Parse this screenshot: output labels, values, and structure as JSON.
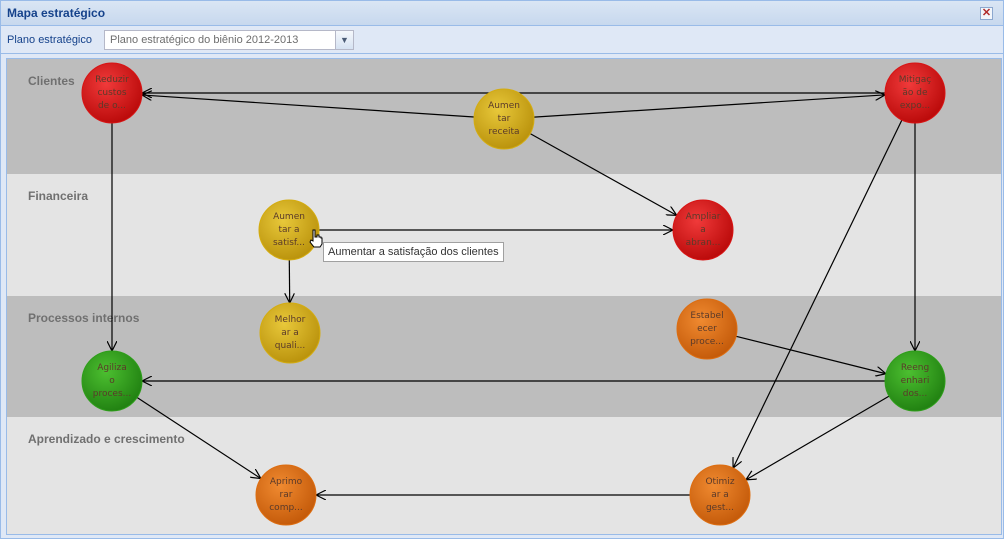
{
  "window": {
    "title": "Mapa estratégico"
  },
  "toolbar": {
    "plan_label": "Plano estratégico",
    "plan_value": "Plano estratégico do biênio 2012-2013"
  },
  "lanes": [
    {
      "label": "Clientes",
      "color": "#bdbdbd"
    },
    {
      "label": "Financeira",
      "color": "#e4e4e4"
    },
    {
      "label": "Processos internos",
      "color": "#bdbdbd"
    },
    {
      "label": "Aprendizado e crescimento",
      "color": "#e4e4e4"
    }
  ],
  "nodes": [
    {
      "id": "reduzir",
      "lines": [
        "Reduzir",
        "custos",
        "de o..."
      ],
      "color": "red"
    },
    {
      "id": "aumentar-receita",
      "lines": [
        "Aumen",
        "tar",
        "receita"
      ],
      "color": "yellow"
    },
    {
      "id": "mitigacao",
      "lines": [
        "Mitigaç",
        "ão de",
        "expo..."
      ],
      "color": "red"
    },
    {
      "id": "aumentar-satisf",
      "lines": [
        "Aumen",
        "tar a",
        "satisf..."
      ],
      "color": "yellow"
    },
    {
      "id": "ampliar",
      "lines": [
        "Ampliar",
        "a",
        "abran..."
      ],
      "color": "red"
    },
    {
      "id": "melhorar",
      "lines": [
        "Melhor",
        "ar a",
        "quali..."
      ],
      "color": "yellow"
    },
    {
      "id": "estabelecer",
      "lines": [
        "Estabel",
        "ecer",
        "proce..."
      ],
      "color": "orange"
    },
    {
      "id": "agilizar",
      "lines": [
        "Agiliza",
        "o",
        "proces..."
      ],
      "color": "green"
    },
    {
      "id": "reengenharia",
      "lines": [
        "Reeng",
        "enhari",
        "dos..."
      ],
      "color": "green"
    },
    {
      "id": "aprimorar",
      "lines": [
        "Aprimo",
        "rar",
        "comp..."
      ],
      "color": "orange"
    },
    {
      "id": "otimizar",
      "lines": [
        "Otimiz",
        "ar a",
        "gest..."
      ],
      "color": "orange"
    }
  ],
  "tooltip": {
    "text": "Aumentar a satisfação dos clientes"
  },
  "colors": {
    "red": "#d81414",
    "yellow": "#d4ac10",
    "green": "#2e9e1a",
    "orange": "#dd6d10"
  }
}
